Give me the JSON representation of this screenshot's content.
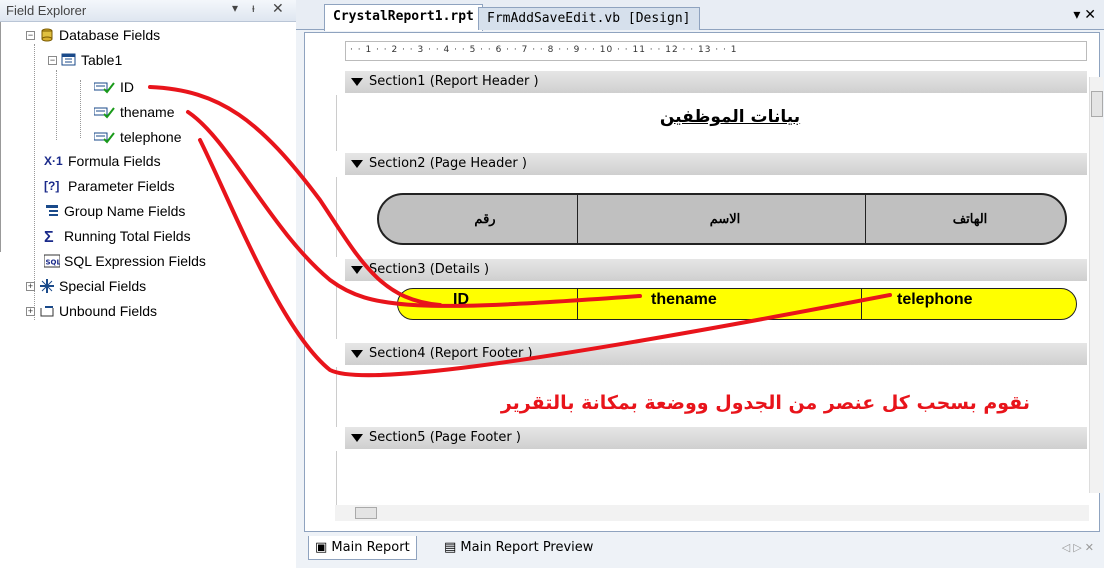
{
  "field_explorer": {
    "title": "Field Explorer",
    "pin_glyph": "▾",
    "dock_glyph": "ᵼ",
    "close_glyph": "✕",
    "items": [
      {
        "label": "Database Fields",
        "expander": "−"
      },
      {
        "label": "Table1",
        "expander": "−"
      },
      {
        "label": "ID"
      },
      {
        "label": "thename"
      },
      {
        "label": "telephone"
      },
      {
        "label": "Formula Fields"
      },
      {
        "label": "Parameter Fields"
      },
      {
        "label": "Group Name Fields"
      },
      {
        "label": "Running Total Fields"
      },
      {
        "label": "SQL Expression Fields"
      },
      {
        "label": "Special Fields",
        "expander": "+"
      },
      {
        "label": "Unbound Fields",
        "expander": "+"
      }
    ]
  },
  "tabs": {
    "active": "CrystalReport1.rpt",
    "inactive": "FrmAddSaveEdit.vb [Design]",
    "controls": "▾ ✕"
  },
  "ruler": "· · 1 · · 2 · · 3 · · 4 · · 5 · · 6 · · 7 · · 8 · · 9 · · 10 · · 11 · · 12 · · 13 · · 1",
  "sections": [
    {
      "label": "Section1 (Report Header )"
    },
    {
      "label": "Section2 (Page Header )"
    },
    {
      "label": "Section3 (Details )"
    },
    {
      "label": "Section4 (Report Footer )"
    },
    {
      "label": "Section5 (Page Footer )"
    }
  ],
  "report_title": "بيانات الموظفين",
  "page_header_cols": [
    "الهاتف",
    "الاسم",
    "رقم"
  ],
  "detail_fields": [
    "ID",
    "thename",
    "telephone"
  ],
  "annotation": "نقوم بسحب كل عنصر من الجدول ووضعة بمكانة بالتقرير",
  "bottom_tabs": {
    "main_report": "Main Report",
    "preview": "Main Report Preview",
    "nav": "◁ ▷ ✕"
  },
  "colors": {
    "highlight_yellow": "#ffff00",
    "arrow_red": "#e8141b",
    "annotation_red": "#e8141b",
    "header_grey": "#c0c0c0"
  }
}
